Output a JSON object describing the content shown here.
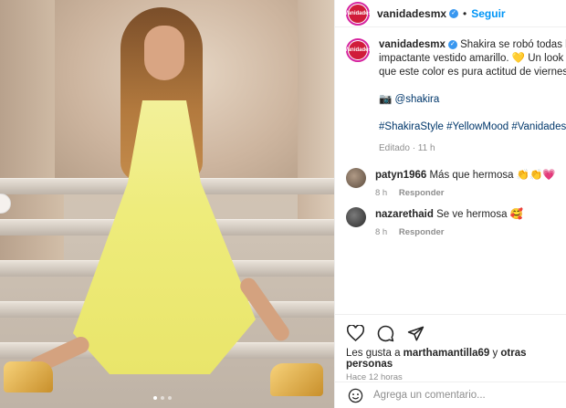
{
  "account": {
    "avatar_text": "Vanidades",
    "username": "vanidadesmx",
    "follow_label": "Seguir",
    "separator": "•"
  },
  "caption": {
    "username": "vanidadesmx",
    "line1": "Shakira se robó todas las mirad",
    "line2": "impactante vestido amarillo. 💛 Un look vibrant",
    "line3": "que este color es pura actitud de viernes.",
    "mention": "📷 @shakira",
    "hashtags": "#ShakiraStyle #YellowMood #VanidadesFashion",
    "meta": "Editado · 11 h"
  },
  "comments": [
    {
      "username": "patyn1966",
      "text": "Más que hermosa 👏👏💗",
      "time": "8 h",
      "reply": "Responder",
      "avatar_color": "#8a7a6a"
    },
    {
      "username": "nazarethaid",
      "text": "Se ve hermosa 🥰",
      "time": "8 h",
      "reply": "Responder",
      "avatar_color": "#4a4a4a"
    }
  ],
  "likes": {
    "prefix": "Les gusta a ",
    "user": "marthamantilla69",
    "middle": " y ",
    "others": "otras personas"
  },
  "posted_ago": "Hace 12 horas",
  "add_comment_placeholder": "Agrega un comentario...",
  "colors": {
    "follow": "#0095f6",
    "verified": "#3897f0",
    "brand": "#d01c3a"
  },
  "icons": [
    "heart-icon",
    "comment-icon",
    "share-icon",
    "emoji-icon",
    "verified-icon"
  ]
}
